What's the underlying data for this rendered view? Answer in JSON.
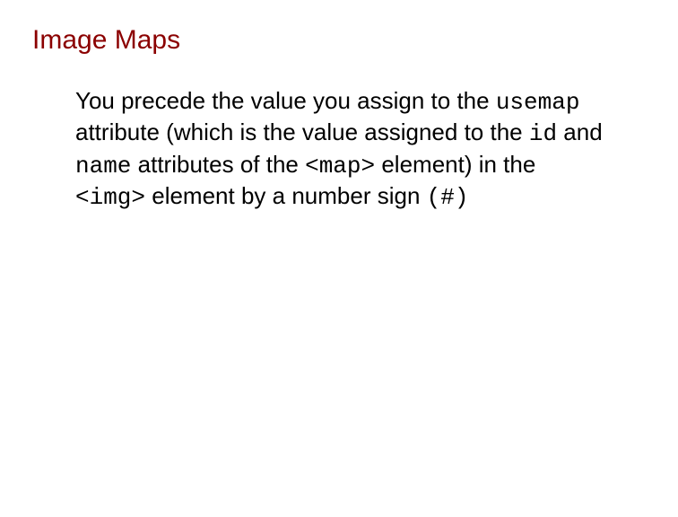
{
  "heading": "Image Maps",
  "body": {
    "t1": "You precede the value you assign to the ",
    "code1": "usemap",
    "t2": " attribute (which is the value assigned to the ",
    "code2": "id",
    "t3": " and ",
    "code3": "name",
    "t4": " attributes of the ",
    "code4": "<map>",
    "t5": " element) in the ",
    "code5": "<img>",
    "t6": " element by a number sign ",
    "code6": "(#)"
  }
}
